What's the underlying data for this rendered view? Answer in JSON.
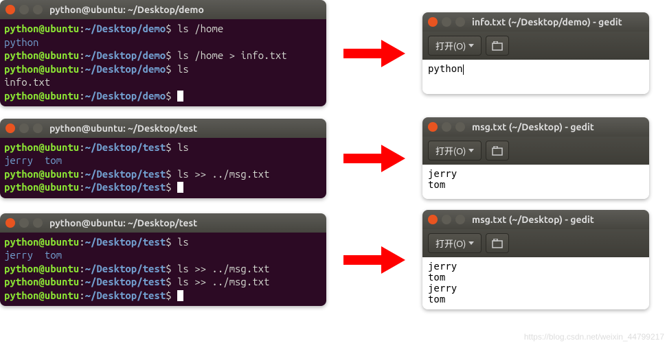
{
  "watermark": "https://blog.csdn.net/weixin_44799217",
  "arrow_color": "#ff0000",
  "terminals": [
    {
      "title": "python@ubuntu: ~/Desktop/demo",
      "lines": [
        {
          "type": "prompt",
          "user": "python@ubuntu",
          "path": "~/Desktop/demo",
          "sep": ":",
          "prompt": "$",
          "cmd": " ls /home"
        },
        {
          "type": "output",
          "class": "out",
          "text": "python"
        },
        {
          "type": "prompt",
          "user": "python@ubuntu",
          "path": "~/Desktop/demo",
          "sep": ":",
          "prompt": "$",
          "cmd": " ls /home > info.txt"
        },
        {
          "type": "prompt",
          "user": "python@ubuntu",
          "path": "~/Desktop/demo",
          "sep": ":",
          "prompt": "$",
          "cmd": " ls"
        },
        {
          "type": "output",
          "class": "out2",
          "text": "info.txt"
        },
        {
          "type": "prompt",
          "user": "python@ubuntu",
          "path": "~/Desktop/demo",
          "sep": ":",
          "prompt": "$",
          "cmd": " ",
          "cursor": true
        }
      ]
    },
    {
      "title": "python@ubuntu: ~/Desktop/test",
      "lines": [
        {
          "type": "prompt",
          "user": "python@ubuntu",
          "path": "~/Desktop/test",
          "sep": ":",
          "prompt": "$",
          "cmd": " ls"
        },
        {
          "type": "output",
          "class": "out",
          "text": "jerry  tom"
        },
        {
          "type": "prompt",
          "user": "python@ubuntu",
          "path": "~/Desktop/test",
          "sep": ":",
          "prompt": "$",
          "cmd": " ls >> ../msg.txt"
        },
        {
          "type": "prompt",
          "user": "python@ubuntu",
          "path": "~/Desktop/test",
          "sep": ":",
          "prompt": "$",
          "cmd": " ",
          "cursor": true
        }
      ]
    },
    {
      "title": "python@ubuntu: ~/Desktop/test",
      "lines": [
        {
          "type": "prompt",
          "user": "python@ubuntu",
          "path": "~/Desktop/test",
          "sep": ":",
          "prompt": "$",
          "cmd": " ls"
        },
        {
          "type": "output",
          "class": "out",
          "text": "jerry  tom"
        },
        {
          "type": "prompt",
          "user": "python@ubuntu",
          "path": "~/Desktop/test",
          "sep": ":",
          "prompt": "$",
          "cmd": " ls >> ../msg.txt"
        },
        {
          "type": "prompt",
          "user": "python@ubuntu",
          "path": "~/Desktop/test",
          "sep": ":",
          "prompt": "$",
          "cmd": " ls >> ../msg.txt"
        },
        {
          "type": "prompt",
          "user": "python@ubuntu",
          "path": "~/Desktop/test",
          "sep": ":",
          "prompt": "$",
          "cmd": " ",
          "cursor": true
        }
      ]
    }
  ],
  "gedits": [
    {
      "title": "info.txt (~/Desktop/demo) - gedit",
      "open_label": "打开(O)",
      "content": "python"
    },
    {
      "title": "msg.txt (~/Desktop) - gedit",
      "open_label": "打开(O)",
      "content": "jerry\ntom"
    },
    {
      "title": "msg.txt (~/Desktop) - gedit",
      "open_label": "打开(O)",
      "content": "jerry\ntom\njerry\ntom"
    }
  ]
}
